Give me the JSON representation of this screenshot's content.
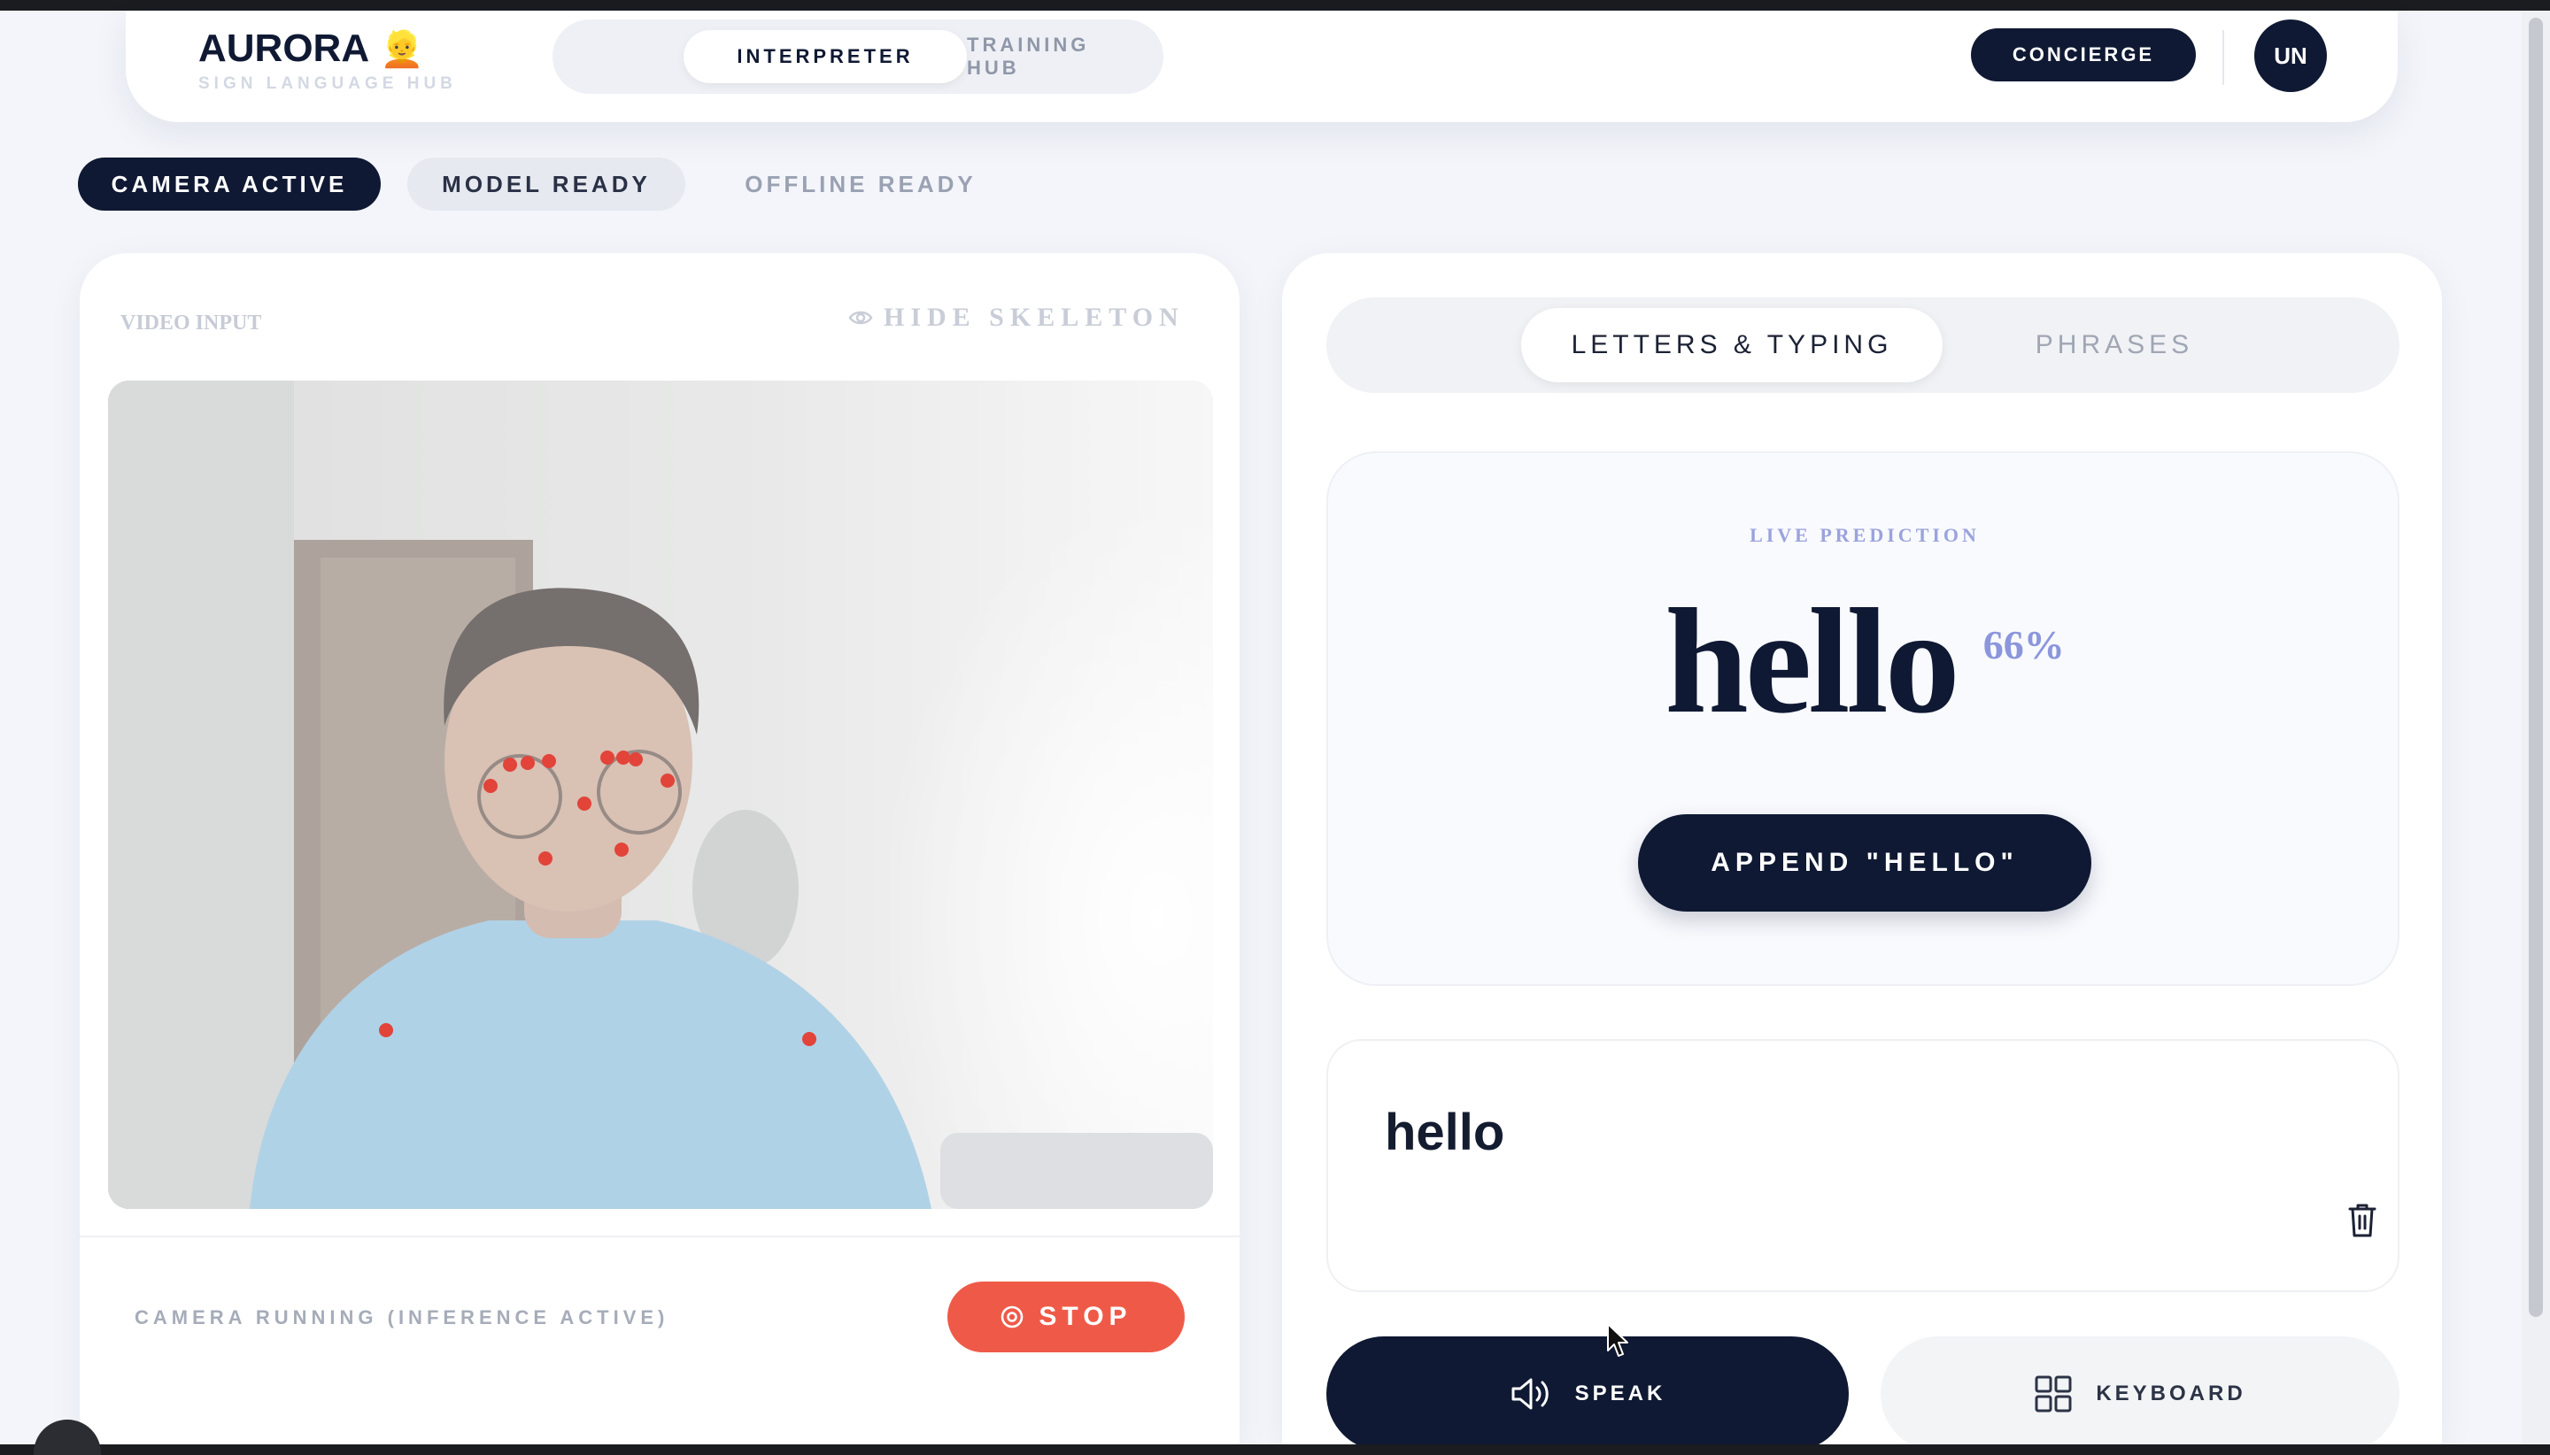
{
  "header": {
    "brand_name": "AURORA",
    "brand_emoji": "👱",
    "brand_subtitle": "SIGN LANGUAGE HUB",
    "nav_tabs": [
      {
        "label": "INTERPRETER",
        "active": true
      },
      {
        "label": "TRAINING HUB",
        "active": false
      }
    ],
    "concierge_label": "CONCIERGE",
    "avatar_initials": "UN"
  },
  "status_chips": [
    {
      "label": "CAMERA ACTIVE",
      "state": "active"
    },
    {
      "label": "MODEL READY",
      "state": "ready"
    },
    {
      "label": "OFFLINE READY",
      "state": "muted"
    }
  ],
  "video_panel": {
    "label": "VIDEO INPUT",
    "toggle_skeleton_label": "HIDE SKELETON",
    "toggle_icon": "eye-icon",
    "switch_camera_icon": "refresh-icon",
    "status_text": "CAMERA RUNNING (INFERENCE ACTIVE)",
    "stop_label": "STOP",
    "stop_icon": "stop-circle-icon"
  },
  "interpreter_panel": {
    "tabs": [
      {
        "label": "LETTERS & TYPING",
        "active": true
      },
      {
        "label": "PHRASES",
        "active": false
      }
    ],
    "live_label": "LIVE PREDICTION",
    "prediction": "hello",
    "confidence": "66%",
    "append_label": "APPEND \"HELLO\"",
    "typed_text": "hello",
    "speak_label": "SPEAK",
    "speak_icon": "speaker-icon",
    "keyboard_label": "KEYBOARD",
    "keyboard_icon": "grid-icon",
    "clear_icon": "trash-icon"
  },
  "colors": {
    "navy": "#0f1933",
    "stop_red": "#ef5a48",
    "accent_lavender": "#8c96dc",
    "landmark_dot": "#e2443a"
  }
}
